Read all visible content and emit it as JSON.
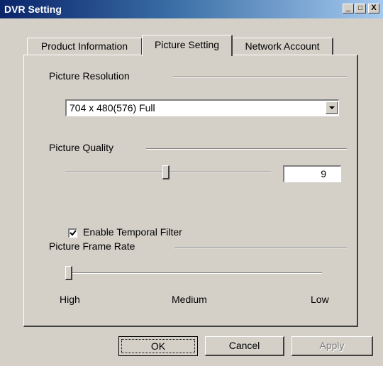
{
  "window": {
    "title": "DVR Setting",
    "controls": {
      "minimize": "_",
      "maximize": "□",
      "close": "X"
    }
  },
  "tabs": [
    {
      "label": "Product Information",
      "active": false
    },
    {
      "label": "Picture Setting",
      "active": true
    },
    {
      "label": "Network Account",
      "active": false
    }
  ],
  "picture_resolution": {
    "label": "Picture Resolution",
    "selected": "704 x 480(576) Full"
  },
  "picture_quality": {
    "label": "Picture Quality",
    "value": "9",
    "slider_fraction": 0.49
  },
  "temporal_filter": {
    "label": "Enable Temporal Filter",
    "checked": true
  },
  "frame_rate": {
    "label": "Picture Frame Rate",
    "slider_fraction": 0.0,
    "ticks": {
      "high": "High",
      "medium": "Medium",
      "low": "Low"
    }
  },
  "buttons": {
    "ok": "OK",
    "cancel": "Cancel",
    "apply": "Apply"
  },
  "colors": {
    "title_gradient_start": "#0a246a",
    "title_gradient_end": "#a6caf0",
    "face": "#d4d0c8"
  }
}
